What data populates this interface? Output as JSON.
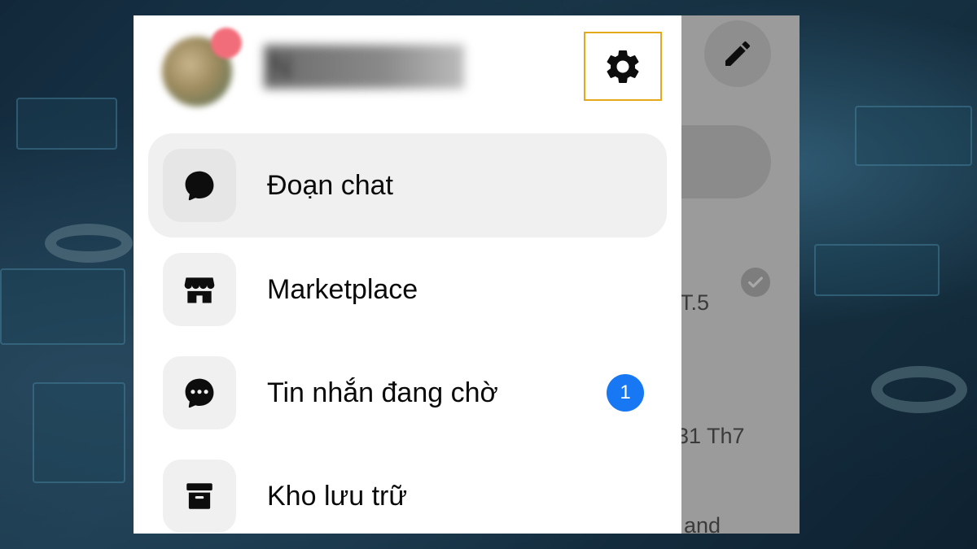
{
  "profile": {
    "name": "N"
  },
  "menu": {
    "items": [
      {
        "label": "Đoạn chat",
        "icon": "chat-bubble-icon",
        "active": true
      },
      {
        "label": "Marketplace",
        "icon": "storefront-icon",
        "active": false
      },
      {
        "label": "Tin nhắn đang chờ",
        "icon": "message-pending-icon",
        "active": false,
        "badge": "1"
      },
      {
        "label": "Kho lưu trữ",
        "icon": "archive-icon",
        "active": false
      }
    ]
  },
  "behind_list": {
    "row1_time": "T.5",
    "row2_time": "31 Th7",
    "row3_text": "and"
  },
  "colors": {
    "highlight_border": "#e6a81b",
    "badge": "#1877f2"
  }
}
